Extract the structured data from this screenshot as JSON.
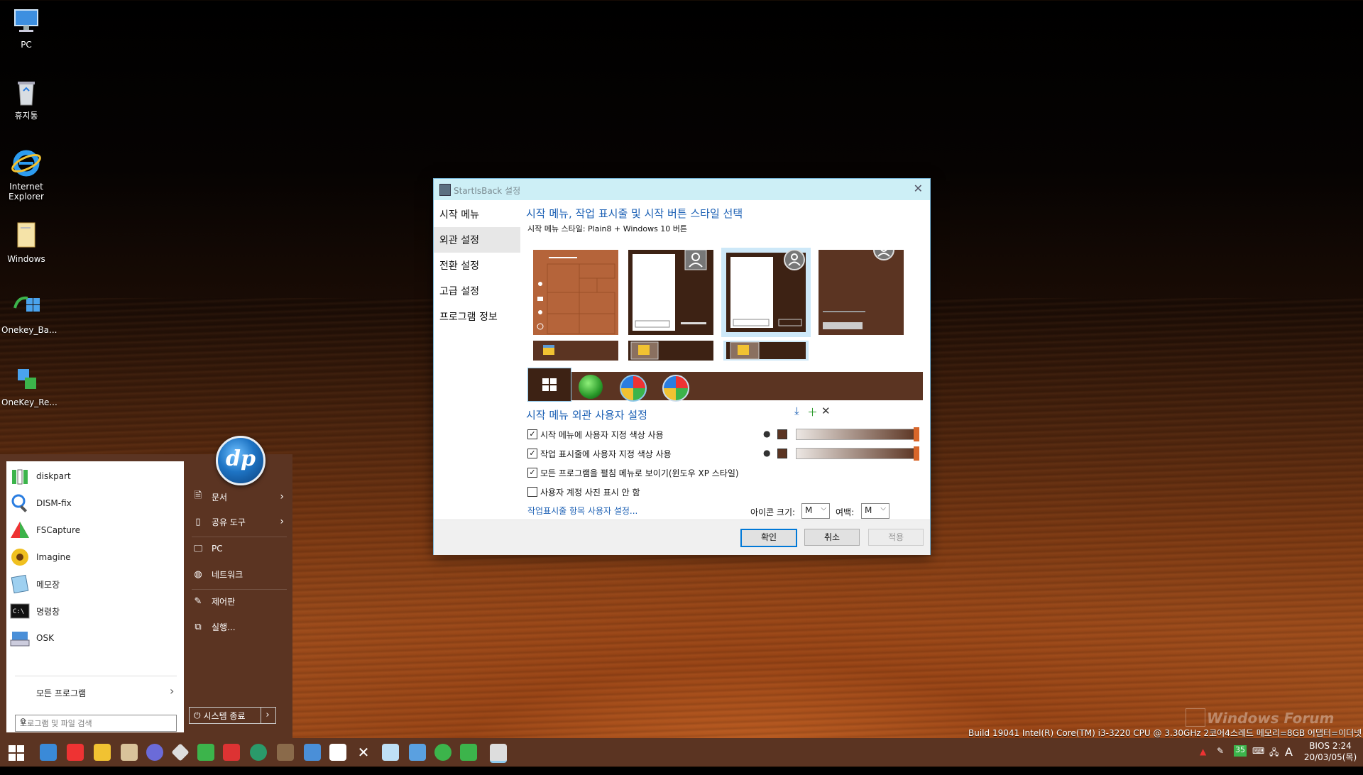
{
  "desktop": {
    "icons": [
      {
        "label": "PC",
        "icon": "computer-icon"
      },
      {
        "label": "휴지통",
        "icon": "recycle-bin-icon"
      },
      {
        "label": "Internet Explorer",
        "icon": "ie-icon"
      },
      {
        "label": "Windows",
        "icon": "folder-icon"
      },
      {
        "label": "Onekey_Ba...",
        "icon": "onekey-backup-icon"
      },
      {
        "label": "OneKey_Re...",
        "icon": "onekey-restore-icon"
      }
    ],
    "build_info": "Build 19041   Intel(R) Core(TM) i3-3220 CPU @ 3.30GHz 2코어4스레드  메모리=8GB  어댑터=이더넷",
    "watermark": "Windows Forum"
  },
  "start_menu": {
    "programs": [
      {
        "label": "diskpart",
        "icon": "diskpart-icon"
      },
      {
        "label": "DISM-fix",
        "icon": "dism-icon"
      },
      {
        "label": "FSCapture",
        "icon": "fscapture-icon"
      },
      {
        "label": "Imagine",
        "icon": "imagine-icon"
      },
      {
        "label": "메모장",
        "icon": "notepad-icon"
      },
      {
        "label": "명령창",
        "icon": "cmd-icon"
      },
      {
        "label": "OSK",
        "icon": "osk-icon"
      }
    ],
    "all_programs": "모든 프로그램",
    "search_placeholder": "프로그램 및 파일 검색",
    "right_items": [
      {
        "label": "문서",
        "icon": "document-icon",
        "submenu": true
      },
      {
        "label": "공유 도구",
        "icon": "share-tools-icon",
        "submenu": true
      },
      {
        "label": "PC",
        "icon": "pc-icon",
        "submenu": false
      },
      {
        "label": "네트워크",
        "icon": "network-icon",
        "submenu": false
      },
      {
        "label": "제어판",
        "icon": "control-panel-icon",
        "submenu": false
      },
      {
        "label": "실행...",
        "icon": "run-icon",
        "submenu": false
      }
    ],
    "shutdown_label": "시스템 종료",
    "user_logo_text": "dp"
  },
  "dialog": {
    "title": "StartIsBack 설정",
    "nav": [
      "시작 메뉴",
      "외관 설정",
      "전환 설정",
      "고급 설정",
      "프로그램 정보"
    ],
    "selected_nav": 1,
    "heading": "시작 메뉴, 작업 표시줄 및 시작 버튼 스타일 선택",
    "style_label": "시작 메뉴 스타일: Plain8 + Windows 10 버튼",
    "custom_heading": "시작 메뉴 외관 사용자 설정",
    "checks": [
      {
        "label": "시작 메뉴에 사용자 지정 색상 사용",
        "checked": true
      },
      {
        "label": "작업 표시줄에 사용자 지정 색상 사용",
        "checked": true
      },
      {
        "label": "모든 프로그램을 펼침 메뉴로 보이기(윈도우 XP 스타일)",
        "checked": true
      },
      {
        "label": "사용자 계정 사진 표시 안 함",
        "checked": false
      }
    ],
    "taskbar_link": "작업표시줄 항목 사용자 설정...",
    "icon_size_label": "아이콘 크기:",
    "icon_size_value": "M",
    "margin_label": "여백:",
    "margin_value": "M",
    "ok": "확인",
    "cancel": "취소",
    "apply": "적용",
    "accent_color": "#5b3422",
    "slider_thumb_color": "#d8662a"
  },
  "taskbar": {
    "color": "#5b3422",
    "tray_letter": "A",
    "tray_badge": "35",
    "clock_top": "BIOS  2:24",
    "clock_bottom": "20/03/05(목)"
  }
}
